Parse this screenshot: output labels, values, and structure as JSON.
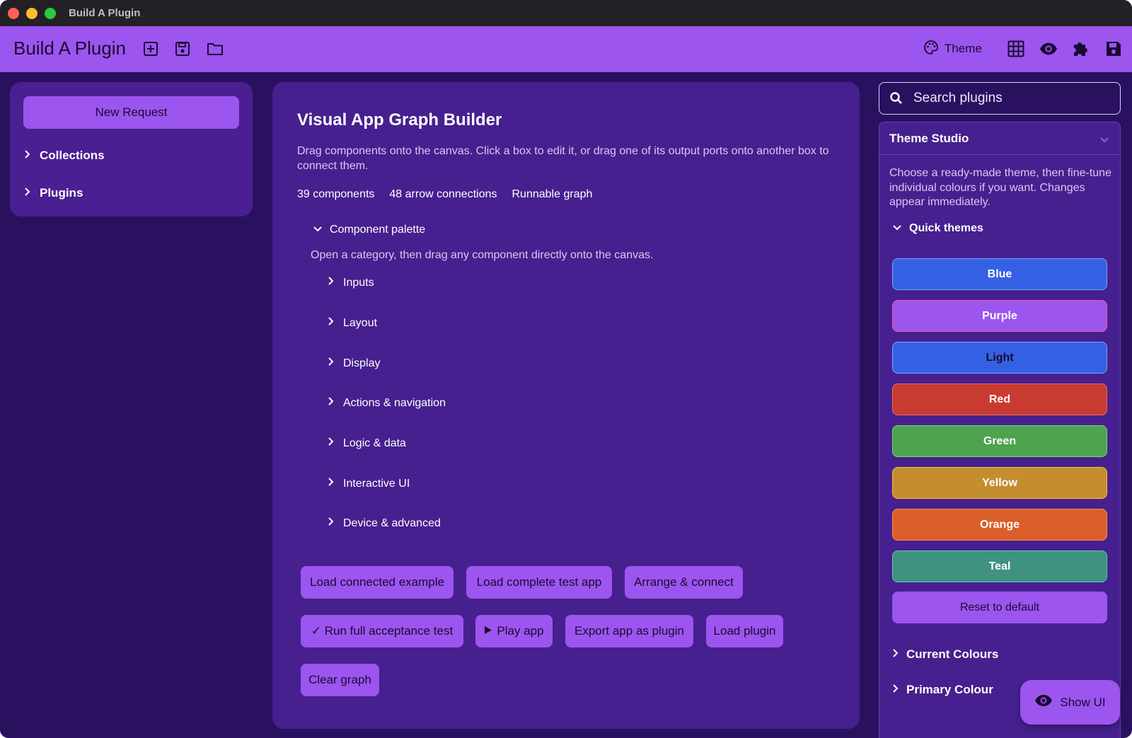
{
  "window": {
    "title": "Build A Plugin"
  },
  "appbar": {
    "title": "Build A Plugin",
    "theme_label": "Theme",
    "icons": [
      "add-box-icon",
      "save-file-icon",
      "folder-icon",
      "palette-icon",
      "grid-icon",
      "eye-icon",
      "puzzle-icon",
      "save-icon"
    ]
  },
  "sidebar": {
    "new_request": "New Request",
    "items": [
      {
        "label": "Collections"
      },
      {
        "label": "Plugins"
      }
    ]
  },
  "main": {
    "title": "Visual App Graph Builder",
    "description": "Drag components onto the canvas. Click a box to edit it, or drag one of its output ports onto another box to connect them.",
    "stats": [
      "39 components",
      "48 arrow connections",
      "Runnable graph"
    ],
    "palette": {
      "label": "Component palette",
      "description": "Open a category, then drag any component directly onto the canvas.",
      "categories": [
        "Inputs",
        "Layout",
        "Display",
        "Actions & navigation",
        "Logic & data",
        "Interactive UI",
        "Device & advanced"
      ]
    },
    "actions": {
      "load_connected": "Load connected example",
      "load_complete": "Load complete test app",
      "arrange": "Arrange & connect",
      "run_test": "✓ Run full acceptance test",
      "play": "Play app",
      "export": "Export app as plugin",
      "load_plugin": "Load plugin",
      "clear": "Clear graph"
    }
  },
  "right": {
    "search": {
      "placeholder": "Search plugins",
      "value": ""
    },
    "studio": {
      "title": "Theme Studio",
      "description": "Choose a ready-made theme, then fine-tune individual colours if you want. Changes appear immediately.",
      "quick_themes_label": "Quick themes",
      "themes": [
        {
          "label": "Blue",
          "color": "#3461e3",
          "border": "#7fa3f7",
          "text": "#ffffff"
        },
        {
          "label": "Purple",
          "color": "#9c55ee",
          "border": "#ee5b8e",
          "text": "#ffffff"
        },
        {
          "label": "Light",
          "color": "#3461e3",
          "border": "#7fa3f7",
          "text": "#1a0a33"
        },
        {
          "label": "Red",
          "color": "#c93b30",
          "border": "#ef6a5e",
          "text": "#ffffff"
        },
        {
          "label": "Green",
          "color": "#4da34e",
          "border": "#7fd27f",
          "text": "#ffffff"
        },
        {
          "label": "Yellow",
          "color": "#c48d2e",
          "border": "#f0c14b",
          "text": "#ffffff"
        },
        {
          "label": "Orange",
          "color": "#da5f2a",
          "border": "#f59150",
          "text": "#ffffff"
        },
        {
          "label": "Teal",
          "color": "#3f9180",
          "border": "#5fc9b5",
          "text": "#ffffff"
        }
      ],
      "reset": "Reset to default",
      "current_colours": "Current Colours",
      "primary_colour": "Primary Colour"
    }
  },
  "fab": {
    "label": "Show UI"
  },
  "colors": {
    "accent": "#9c55ee",
    "background": "#2a1160",
    "panel": "#46208e",
    "sidebar_panel": "#4a1f92"
  }
}
